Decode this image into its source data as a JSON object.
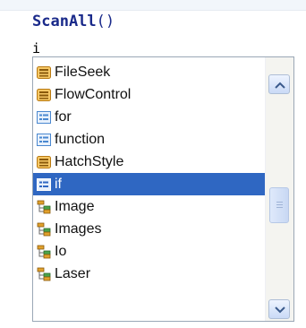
{
  "editor": {
    "line1_function": "ScanAll",
    "line1_parens": "()",
    "line2_text": "i"
  },
  "completion_list": {
    "selected_index": 5,
    "items": [
      {
        "label": "FileSeek",
        "icon": "enum-icon"
      },
      {
        "label": "FlowControl",
        "icon": "enum-icon"
      },
      {
        "label": "for",
        "icon": "keyword-icon"
      },
      {
        "label": "function",
        "icon": "keyword-icon"
      },
      {
        "label": "HatchStyle",
        "icon": "enum-icon"
      },
      {
        "label": "if",
        "icon": "keyword-icon"
      },
      {
        "label": "Image",
        "icon": "class-tree-icon"
      },
      {
        "label": "Images",
        "icon": "class-tree-icon"
      },
      {
        "label": "Io",
        "icon": "class-tree-icon"
      },
      {
        "label": "Laser",
        "icon": "class-tree-icon"
      }
    ],
    "scrollbar": {
      "position_fraction": 0.55
    }
  },
  "colors": {
    "selection": "#2f67c2",
    "code_keyword": "#1a2a8a",
    "enum_icon": "#e8a33a",
    "keyword_icon": "#4a88d0",
    "class_icon": "#d59a22"
  }
}
